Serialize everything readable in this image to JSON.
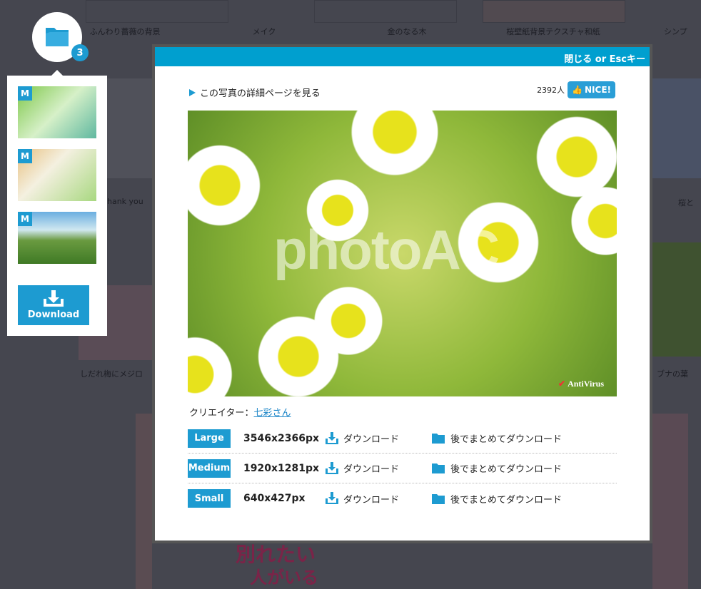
{
  "background": {
    "captions": [
      "ふんわり薔薇の背景",
      "メイク",
      "金のなる木",
      "桜壁紙背景テクスチャ和紙",
      "シンプ",
      "hank you",
      "桜と",
      "しだれ梅にメジロ",
      "ブナの葉",
      "別れたい",
      "人がいる"
    ]
  },
  "collection": {
    "count": "3",
    "thumb_badge": "M",
    "download_label": "Download"
  },
  "modal": {
    "close_label": "閉じる or Escキー",
    "detail_link": "この写真の詳細ページを見る",
    "nice_count": "2392人",
    "nice_label": "NICE!",
    "watermark": "photoAC",
    "antivirus": "AntiVirus",
    "creator_label": "クリエイター：",
    "creator_name": "七彩さん",
    "sizes": [
      {
        "label": "Large",
        "dimensions": "3546x2366px",
        "download": "ダウンロード",
        "later": "後でまとめてダウンロード"
      },
      {
        "label": "Medium",
        "dimensions": "1920x1281px",
        "download": "ダウンロード",
        "later": "後でまとめてダウンロード"
      },
      {
        "label": "Small",
        "dimensions": "640x427px",
        "download": "ダウンロード",
        "later": "後でまとめてダウンロード"
      }
    ]
  },
  "colors": {
    "accent": "#1d9bd1",
    "header": "#009fcf"
  }
}
